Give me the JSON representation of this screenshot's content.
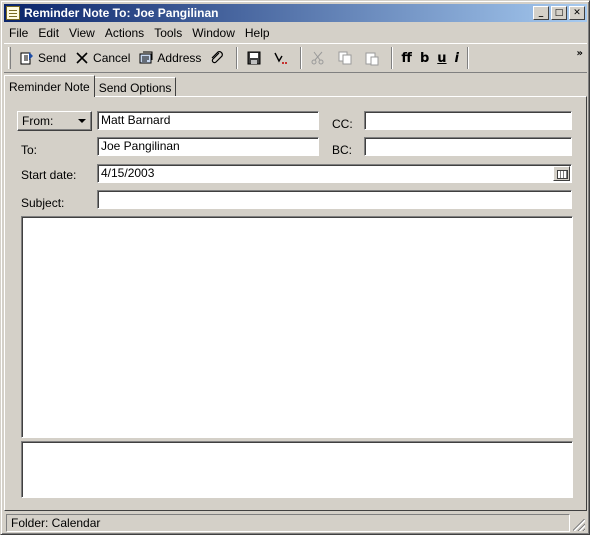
{
  "window": {
    "title": "Reminder Note To: Joe Pangilinan",
    "minimize_glyph": "_",
    "maximize_glyph": "□",
    "close_glyph": "✕"
  },
  "menu": [
    "File",
    "Edit",
    "View",
    "Actions",
    "Tools",
    "Window",
    "Help"
  ],
  "toolbar": {
    "send_label": "Send",
    "cancel_label": "Cancel",
    "address_label": "Address",
    "format_font_label": "ff",
    "bold_label": "b",
    "underline_label": "u",
    "italic_label": "i",
    "more_label": "»"
  },
  "tabs": {
    "reminder_note": "Reminder Note",
    "send_options": "Send Options"
  },
  "form": {
    "from_button": "From:",
    "from_value": "Matt Barnard",
    "to_label": "To:",
    "to_value": "Joe Pangilinan",
    "cc_label": "CC:",
    "cc_value": "",
    "bc_label": "BC:",
    "bc_value": "",
    "start_date_label": "Start date:",
    "start_date_value": "4/15/2003",
    "subject_label": "Subject:",
    "subject_value": ""
  },
  "status": {
    "folder": "Folder: Calendar"
  }
}
